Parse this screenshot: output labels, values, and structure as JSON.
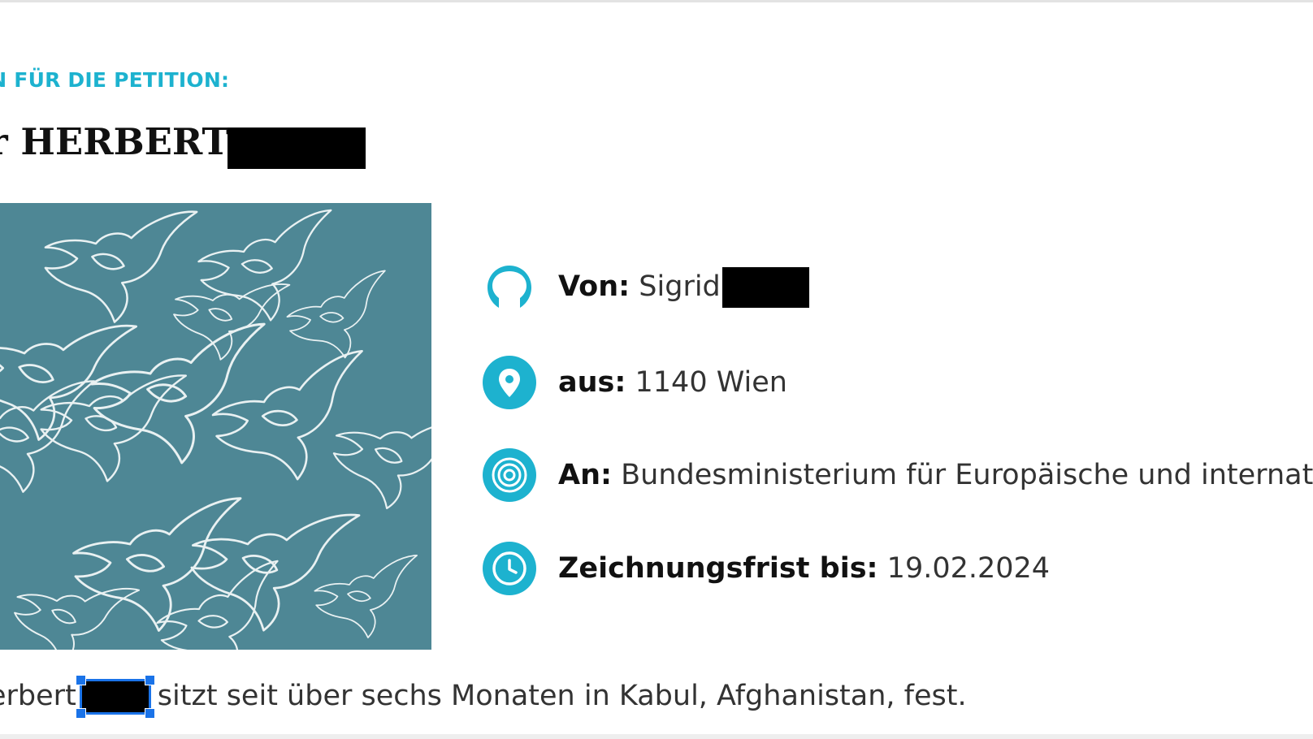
{
  "colors": {
    "accent": "#1db2cf",
    "image_bg": "#4e8795",
    "selection": "#1a73e8",
    "redaction": "#000000"
  },
  "header": {
    "eyebrow": "EN FÜR DIE PETITION:",
    "title": "r HERBERT"
  },
  "image": {
    "icon": "dove-pattern-image"
  },
  "meta": {
    "author": {
      "icon": "user-icon",
      "label": "Von:",
      "value": "Sigrid"
    },
    "location": {
      "icon": "location-pin-icon",
      "label": "aus:",
      "value": "1140 Wien"
    },
    "recipient": {
      "icon": "target-icon",
      "label": "An:",
      "value": "Bundesministerium für Europäische und internatina"
    },
    "deadline": {
      "icon": "clock-icon",
      "label": "Zeichnungsfrist bis:",
      "value": "19.02.2024"
    }
  },
  "body": {
    "prefix": "erbert",
    "suffix": "sitzt seit über sechs Monaten in Kabul, Afghanistan, fest."
  }
}
